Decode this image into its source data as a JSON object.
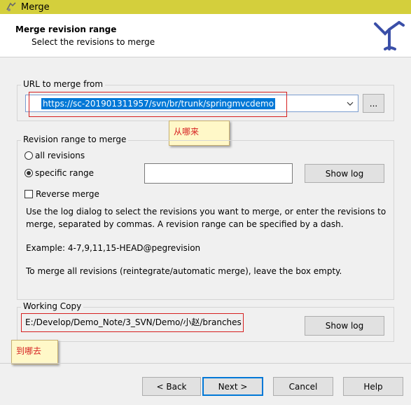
{
  "window": {
    "title": "Merge"
  },
  "header": {
    "title": "Merge revision range",
    "subtitle": "Select the revisions to merge"
  },
  "url_group": {
    "label": "URL to merge from",
    "url_value": "https://sc-201901311957/svn/br/trunk/springmvcdemo",
    "browse_label": "..."
  },
  "annotations": {
    "from_note": "从哪来",
    "to_note": "到哪去"
  },
  "revision_group": {
    "label": "Revision range to merge",
    "all_revisions": "all revisions",
    "specific_range": "specific range",
    "range_value": "",
    "show_log": "Show log",
    "reverse_merge": "Reverse merge",
    "help1_line1": "Use the log dialog to select the revisions you want to merge, or enter the revisions to",
    "help1_line2": "merge, separated by commas. A revision range can be specified by a dash.",
    "example": "Example: 4-7,9,11,15-HEAD@pegrevision",
    "help2": "To merge all revisions (reintegrate/automatic merge), leave the box empty."
  },
  "working_copy": {
    "label": "Working Copy",
    "path": "E:/Develop/Demo_Note/3_SVN/Demo/小赵/branches",
    "show_log": "Show log"
  },
  "footer": {
    "back": "< Back",
    "next": "Next >",
    "cancel": "Cancel",
    "help": "Help"
  },
  "state": {
    "selected_range_mode": "specific range",
    "reverse_merge_checked": false
  },
  "colors": {
    "titlebar": "#d4cf3c",
    "selection": "#0078d7",
    "annotation_red": "#d62020",
    "note_bg": "#fff8c8"
  }
}
